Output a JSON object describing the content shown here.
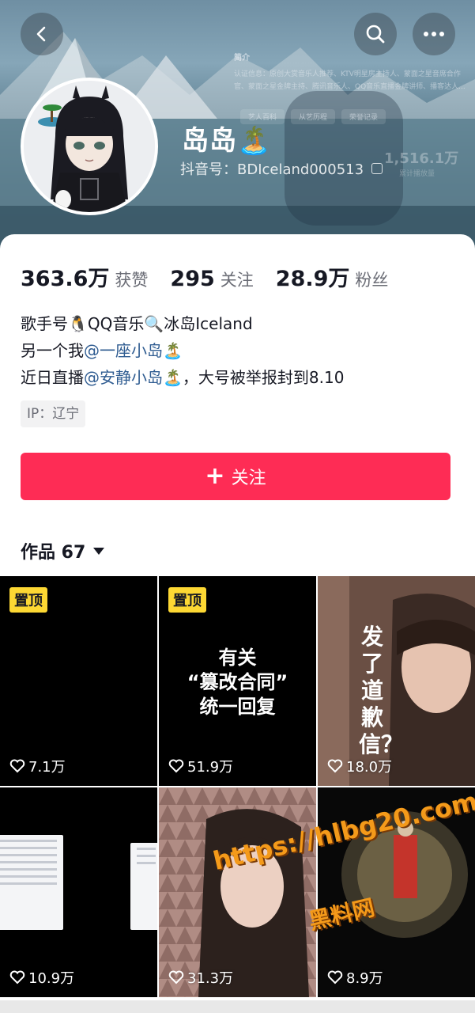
{
  "header": {
    "ghost_title": "简介",
    "ghost_intro": "认证信息：原创大赏音乐人推荐、KTV明星房主持人、蒙面之星音席合作官、蒙面之星金牌主持、腾讯音乐人、QQ音乐直播金牌讲师、播客达人...",
    "ghost_tags": [
      "艺人百科",
      "从艺历程",
      "荣誉记录"
    ],
    "ghost_count": "1,516.1万",
    "ghost_count_label": "累计播放量"
  },
  "profile": {
    "nickname": "岛岛🏝️",
    "douyin_id": "抖音号：BDIceland000513"
  },
  "stats": [
    {
      "value": "363.6万",
      "label": "获赞"
    },
    {
      "value": "295",
      "label": "关注"
    },
    {
      "value": "28.9万",
      "label": "粉丝"
    }
  ],
  "bio": {
    "line1": "歌手号🐧QQ音乐🔍冰岛Iceland",
    "line2_prefix": "另一个我",
    "line2_mention": "@一座小岛🏝️",
    "line3_prefix": "近日直播",
    "line3_mention": "@安静小岛🏝️",
    "line3_suffix": "，大号被举报封到8.10",
    "ip": "IP：辽宁"
  },
  "follow_button": {
    "label": "关注"
  },
  "works": {
    "label": "作品 67"
  },
  "videos": [
    {
      "pinned": "置顶",
      "likes": "7.1万"
    },
    {
      "pinned": "置顶",
      "likes": "51.9万",
      "cover_text": [
        "有关",
        "“篡改合同”",
        "统一回复"
      ]
    },
    {
      "likes": "18.0万",
      "cover_text": "发了道歉信？"
    },
    {
      "likes": "10.9万"
    },
    {
      "likes": "31.3万"
    },
    {
      "likes": "8.9万"
    }
  ],
  "watermark": {
    "url": "https://hlbg20.com",
    "name": "黑料网"
  },
  "colors": {
    "accent": "#fe2c55",
    "mention": "#2f5c91",
    "pin": "#fdd833"
  }
}
